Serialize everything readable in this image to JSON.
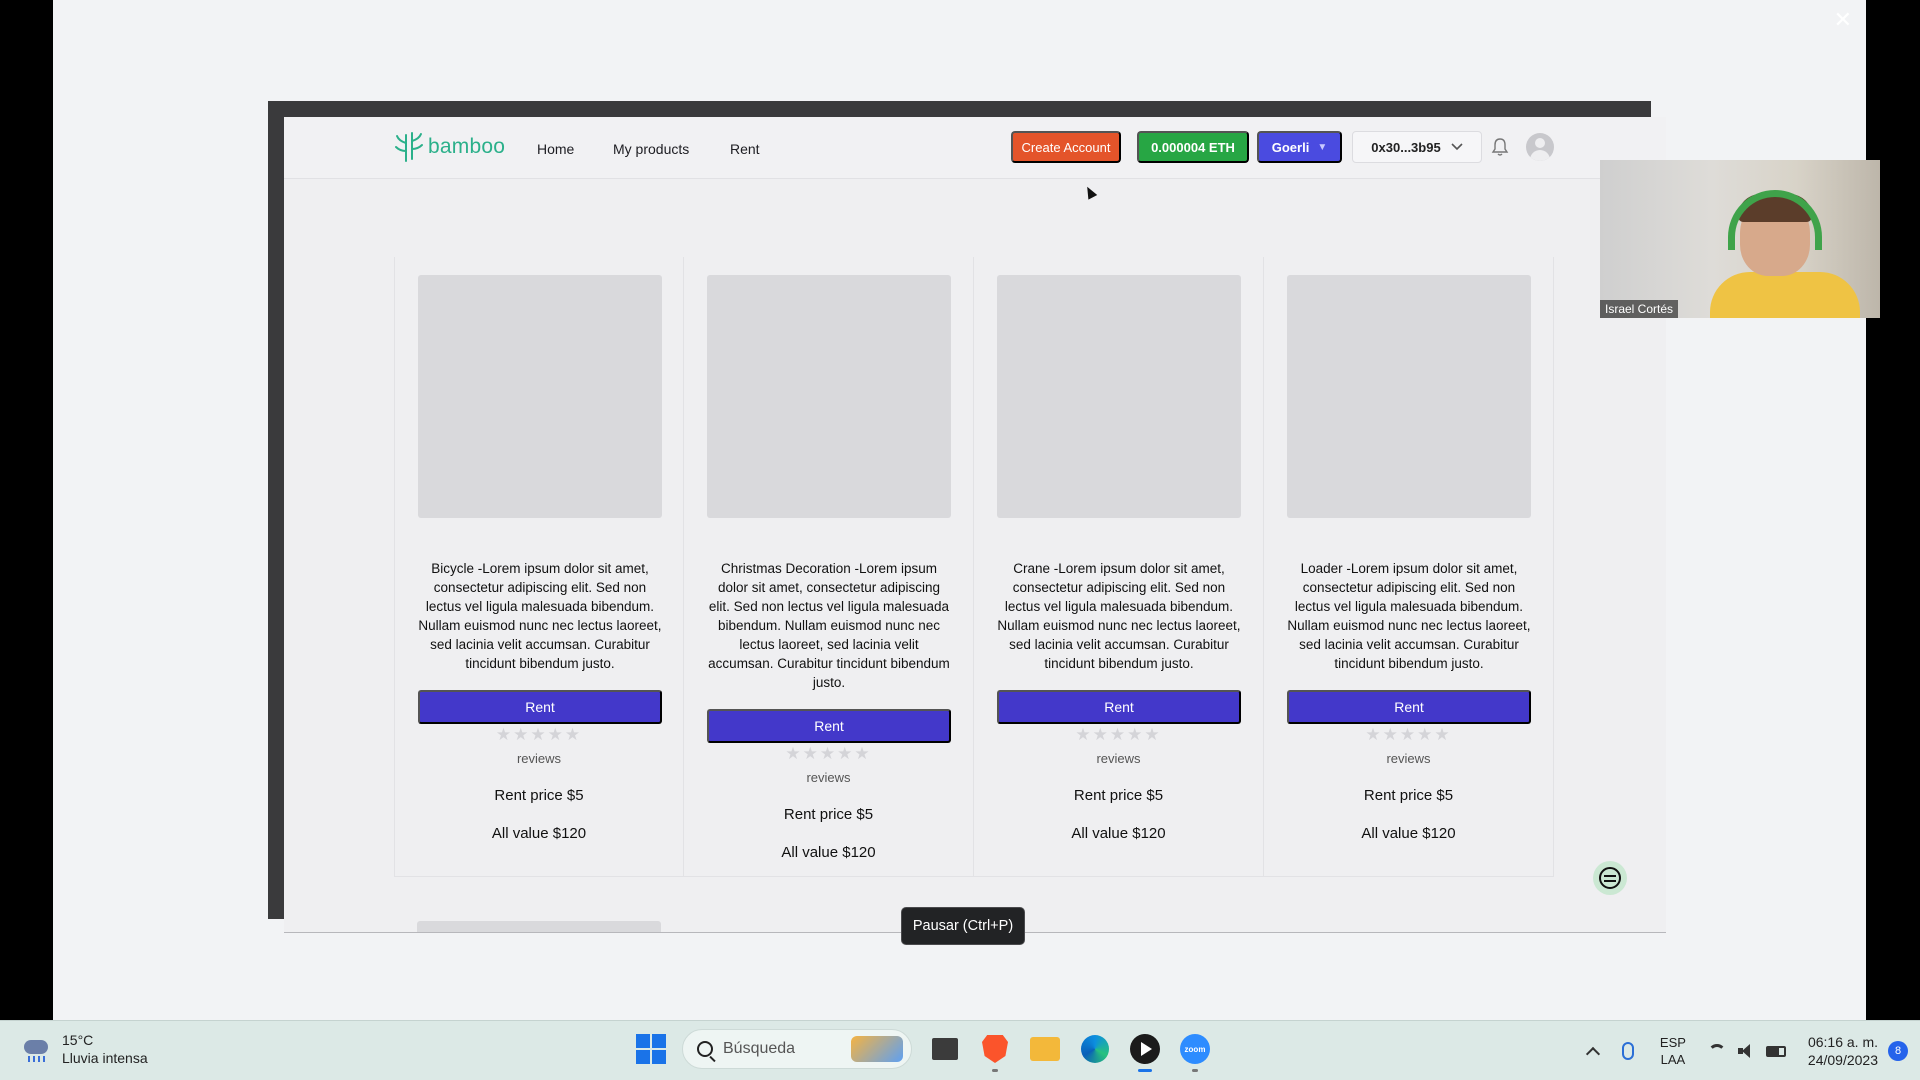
{
  "app": {
    "logo_text": "bamboo",
    "nav": [
      "Home",
      "My products",
      "Rent"
    ],
    "create_account": "Create Account",
    "balance": "0.000004 ETH",
    "network": "Goerli",
    "account": "0x30...3b95"
  },
  "products": [
    {
      "description": "Bicycle -Lorem ipsum dolor sit amet, consectetur adipiscing elit. Sed non lectus vel ligula malesuada bibendum. Nullam euismod nunc nec lectus laoreet, sed lacinia velit accumsan. Curabitur tincidunt bibendum justo.",
      "button": "Rent",
      "stars": "★★★★★",
      "rating": 0,
      "reviews": "reviews",
      "price": "Rent price $5",
      "value": "All value $120"
    },
    {
      "description": "Christmas Decoration -Lorem ipsum dolor sit amet, consectetur adipiscing elit. Sed non lectus vel ligula malesuada bibendum. Nullam euismod nunc nec lectus laoreet, sed lacinia velit accumsan. Curabitur tincidunt bibendum justo.",
      "button": "Rent",
      "stars": "★★★★★",
      "rating": 0,
      "reviews": "reviews",
      "price": "Rent price $5",
      "value": "All value $120"
    },
    {
      "description": "Crane -Lorem ipsum dolor sit amet, consectetur adipiscing elit. Sed non lectus vel ligula malesuada bibendum. Nullam euismod nunc nec lectus laoreet, sed lacinia velit accumsan. Curabitur tincidunt bibendum justo.",
      "button": "Rent",
      "stars": "★★★★★",
      "rating": 0,
      "reviews": "reviews",
      "price": "Rent price $5",
      "value": "All value $120"
    },
    {
      "description": "Loader -Lorem ipsum dolor sit amet, consectetur adipiscing elit. Sed non lectus vel ligula malesuada bibendum. Nullam euismod nunc nec lectus laoreet, sed lacinia velit accumsan. Curabitur tincidunt bibendum justo.",
      "button": "Rent",
      "stars": "★★★★★",
      "rating": 0,
      "reviews": "reviews",
      "price": "Rent price $5",
      "value": "All value $120"
    }
  ],
  "tooltip": "Pausar (Ctrl+P)",
  "participant": {
    "name": "Israel Cortés"
  },
  "viewer": {
    "close": "✕"
  },
  "taskbar": {
    "temperature": "15°C",
    "weather": "Lluvia intensa",
    "search_placeholder": "Búsqueda",
    "apps": [
      "files-icon",
      "brave-icon",
      "folder-icon",
      "edge-icon",
      "player-icon",
      "zoom-icon"
    ],
    "zoom_label": "zoom",
    "lang_top": "ESP",
    "lang_bottom": "LAA",
    "time": "06:16 a. m.",
    "date": "24/09/2023",
    "notifications": "8"
  },
  "colors": {
    "brand": "#2bb08a",
    "create_button": "#e4542a",
    "balance_button": "#27a644",
    "network_button": "#4a4be0",
    "rent_button": "#4338ca"
  }
}
